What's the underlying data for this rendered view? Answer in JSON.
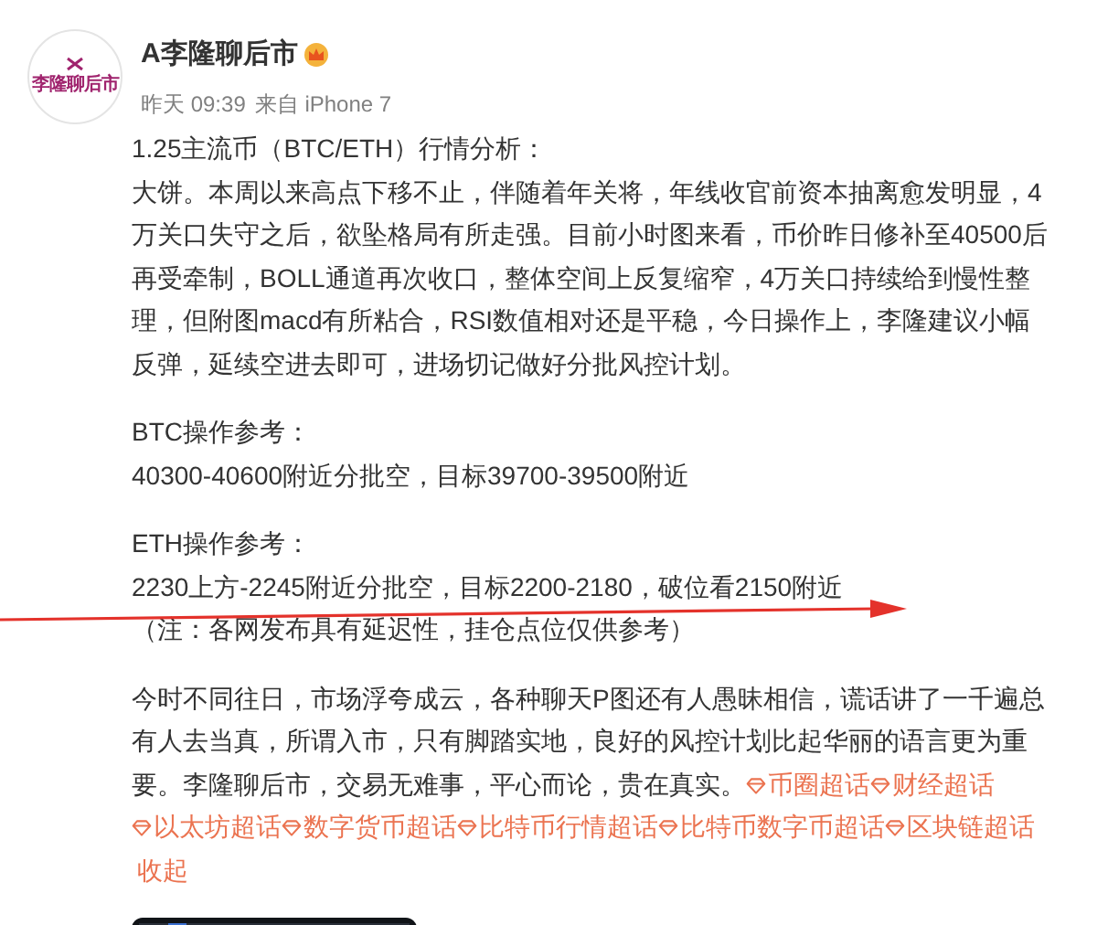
{
  "post": {
    "avatar": {
      "label": "李隆聊后市"
    },
    "author": "A李隆聊后市",
    "time": "昨天 09:39",
    "source": "来自 iPhone 7",
    "blocks": [
      {
        "lines": [
          "1.25主流币（BTC/ETH）行情分析：",
          "大饼。本周以来高点下移不止，伴随着年关将，年线收官前资本抽离愈发明显，4万关口失守之后，欲坠格局有所走强。目前小时图来看，币价昨日修补至40500后再受牵制，BOLL通道再次收口，整体空间上反复缩窄，4万关口持续给到慢性整理，但附图macd有所粘合，RSI数值相对还是平稳，今日操作上，李隆建议小幅反弹，延续空进去即可，进场切记做好分批风控计划。"
        ]
      },
      {
        "lines": [
          "BTC操作参考：",
          "40300-40600附近分批空，目标39700-39500附近"
        ]
      },
      {
        "lines": [
          "ETH操作参考：",
          "2230上方-2245附近分批空，目标2200-2180，破位看2150附近",
          "（注：各网发布具有延迟性，挂仓点位仅供参考）"
        ]
      },
      {
        "lines": [
          "今时不同往日，市场浮夸成云，各种聊天P图还有人愚昧相信，谎话讲了一千遍总",
          "有人去当真，所谓入市，只有脚踏实地，良好的风控计划比起华丽的语言更为重",
          "要。李隆聊后市，交易无难事，平心而论，贵在真实。"
        ]
      }
    ],
    "topics": [
      "币圈超话",
      "财经超话",
      "以太坊超话",
      "数字货币超话",
      "比特币行情超话",
      "比特币数字币超话",
      "区块链超话"
    ],
    "collapse": "收起"
  }
}
